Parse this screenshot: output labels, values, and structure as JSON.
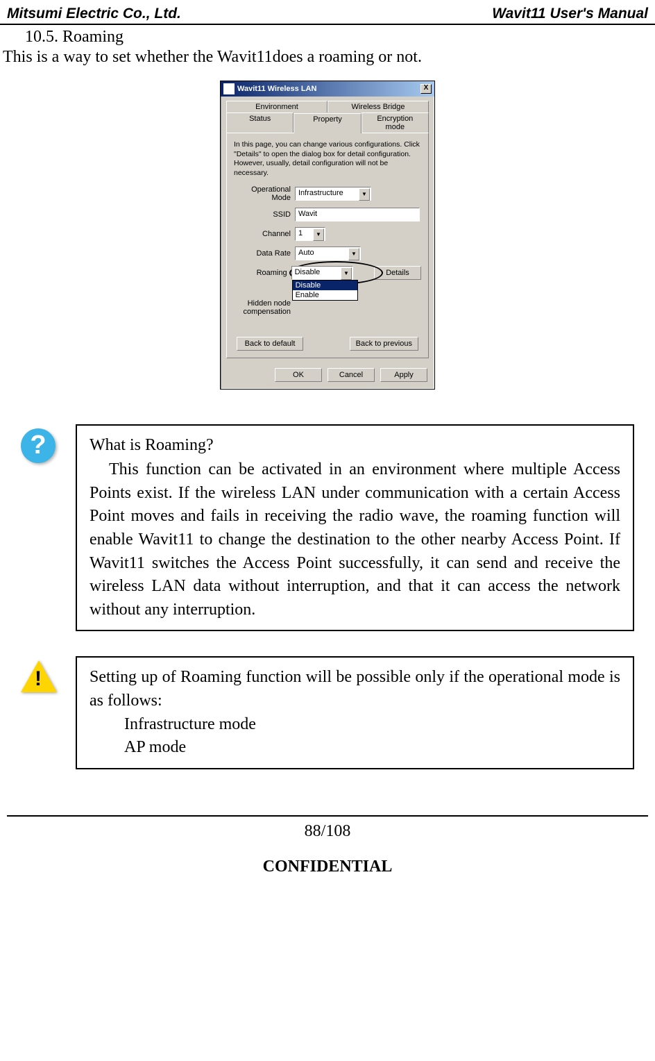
{
  "header": {
    "left": "Mitsumi Electric Co., Ltd.",
    "right": "Wavit11 User's Manual"
  },
  "section": {
    "heading": "10.5. Roaming",
    "intro": "This is a way to set whether the Wavit11does a roaming or not."
  },
  "dialog": {
    "title": "Wavit11 Wireless LAN",
    "close": "X",
    "tabs_row1": [
      "Environment",
      "Wireless Bridge"
    ],
    "tabs_row2": [
      "Status",
      "Property",
      "Encryption mode"
    ],
    "instructions": "In this page, you can change various configurations. Click \"Details\" to open the dialog box for detail configuration. However, usually, detail configuration will not be necessary.",
    "fields": {
      "op_mode": {
        "label": "Operational Mode",
        "value": "Infrastructure"
      },
      "ssid": {
        "label": "SSID",
        "value": "Wavit"
      },
      "channel": {
        "label": "Channel",
        "value": "1"
      },
      "data_rate": {
        "label": "Data Rate",
        "value": "Auto"
      },
      "roaming": {
        "label": "Roaming",
        "value": "Disable",
        "options": [
          "Disable",
          "Enable"
        ]
      },
      "hidden": {
        "label": "Hidden node compensation"
      }
    },
    "buttons": {
      "details": "Details",
      "back_default": "Back to default",
      "back_prev": "Back to previous",
      "ok": "OK",
      "cancel": "Cancel",
      "apply": "Apply"
    }
  },
  "help_box": {
    "title": "What is Roaming?",
    "body": "This function can be activated in an environment where multiple Access Points exist. If the wireless LAN under communication with a certain Access Point moves and fails in receiving the radio wave, the roaming function will enable Wavit11 to change the destination to the other nearby Access Point. If Wavit11 switches the Access Point successfully, it can send and receive the wireless LAN data without interruption, and that it can access the network without any interruption."
  },
  "warn_box": {
    "line1": "Setting up of Roaming function will be possible only if the operational mode is as follows:",
    "item1": "Infrastructure mode",
    "item2": "AP mode"
  },
  "footer": {
    "page": "88/108",
    "confidential": "CONFIDENTIAL"
  }
}
